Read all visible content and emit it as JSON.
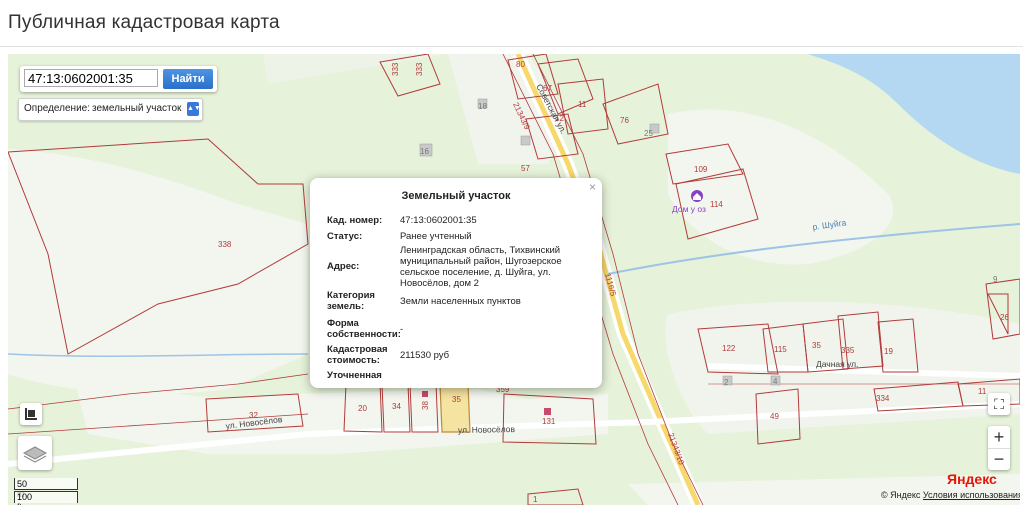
{
  "page": {
    "title": "Публичная кадастровая карта"
  },
  "search": {
    "value": "47:13:0602001:35",
    "button_label": "Найти"
  },
  "definition": {
    "label": "Определение:",
    "value": "земельный участок"
  },
  "popup": {
    "title": "Земельный участок",
    "close": "×",
    "rows": [
      {
        "key": "Кад. номер:",
        "value": "47:13:0602001:35"
      },
      {
        "key": "Статус:",
        "value": "Ранее учтенный"
      },
      {
        "key": "Адрес:",
        "value": "Ленинградская область, Тихвинский муниципальный район, Шугозерское сельское поселение, д. Шуйга, ул. Новосёлов, дом 2"
      },
      {
        "key": "Категория земель:",
        "value": "Земли населенных пунктов"
      },
      {
        "key": "Форма собственности:",
        "value": "-"
      },
      {
        "key": "Кадастровая стоимость:",
        "value": "211530 руб"
      },
      {
        "key": "Уточненная",
        "value": ""
      }
    ]
  },
  "map": {
    "streets": {
      "sovetskaya": "Советская ул.",
      "novoselov": "ул. Новосёлов",
      "dachnaya": "Дачная ул.",
      "river": "р. Шуйга"
    },
    "quarters": {
      "q1": "21343/9",
      "q2": "21343/10",
      "q3": "1116/5"
    },
    "poi": {
      "label": "Дом у оз",
      "icon": "house-pin-icon"
    },
    "parcels": [
      "333",
      "80",
      "67",
      "11",
      "76",
      "12",
      "18",
      "25",
      "16",
      "57",
      "109",
      "114",
      "338",
      "9",
      "26",
      "122",
      "115",
      "35",
      "335",
      "19",
      "2",
      "4",
      "49",
      "334",
      "11",
      "32",
      "20",
      "34",
      "38",
      "35",
      "359",
      "131",
      "1"
    ]
  },
  "controls": {
    "zoom_in": "+",
    "zoom_out": "−",
    "fullscreen": "⛶",
    "layers": "layers-icon",
    "ruler": "ruler-icon"
  },
  "scale": {
    "metric": "50 m",
    "imperial": "100 ft"
  },
  "attribution": {
    "copyright": "© Яндекс",
    "terms": "Условия использования",
    "logo": "Яндекс"
  },
  "colors": {
    "parcel": "#b23a3a",
    "water": "#b5d8f2",
    "land": "#e6f2d9",
    "road": "#ffffff",
    "selected": "#f4e3a1"
  }
}
